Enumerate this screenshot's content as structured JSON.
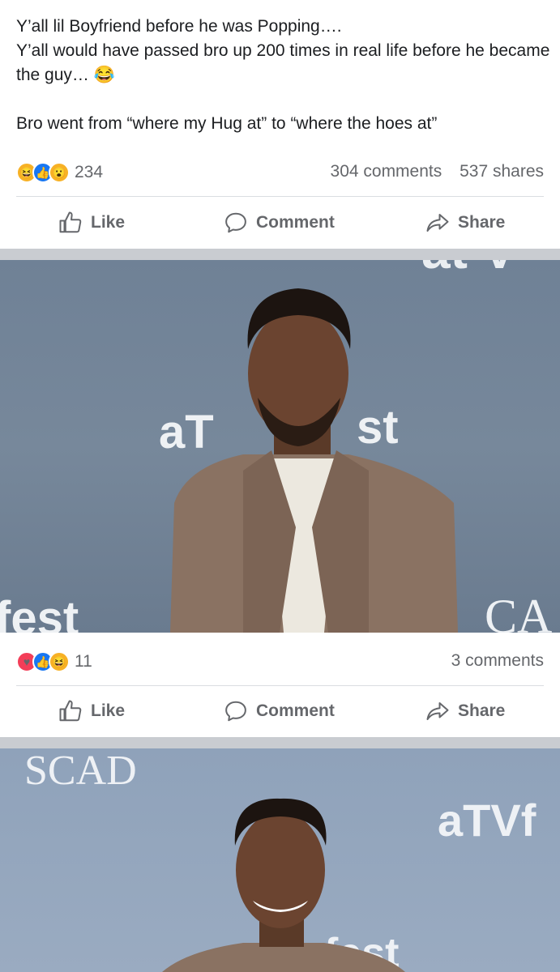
{
  "post": {
    "line1": "Y’all lil Boyfriend before he was Popping….",
    "line2": "Y’all would have passed bro up 200 times in real life before he became the guy… 😂",
    "line3": "Bro went from “where my Hug at” to “where the hoes at”",
    "reaction_count": "234",
    "comments": "304 comments",
    "shares": "537 shares"
  },
  "actions": {
    "like": "Like",
    "comment": "Comment",
    "share": "Share"
  },
  "photo1": {
    "reaction_count": "11",
    "comments": "3 comments",
    "backdrop_text": [
      "aT",
      "st",
      "fest",
      "CA",
      "at V"
    ]
  },
  "photo2": {
    "backdrop_text": [
      "SCAD",
      "aTVf",
      "fest"
    ]
  },
  "colors": {
    "like_blue": "#1877f2",
    "love_red": "#f33e58",
    "haha_yellow": "#f7b125",
    "band": "#c9ccd1"
  }
}
